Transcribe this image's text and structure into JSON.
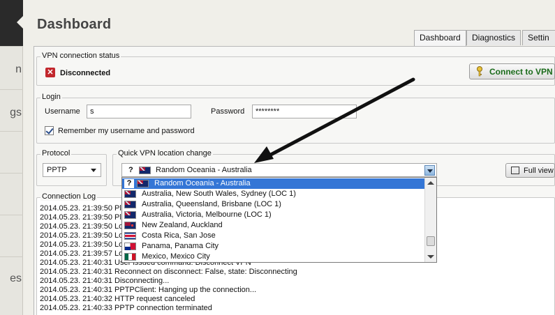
{
  "sidebar": {
    "items": [
      "n",
      "gs",
      "es"
    ]
  },
  "header": {
    "title": "Dashboard"
  },
  "tabs": [
    {
      "label": "Dashboard",
      "active": true
    },
    {
      "label": "Diagnostics"
    },
    {
      "label": "Settin"
    }
  ],
  "vpn_status": {
    "title": "VPN connection status",
    "status": "Disconnected",
    "connect_label": "Connect to VPN"
  },
  "login": {
    "title": "Login",
    "username_label": "Username",
    "username_value": "s",
    "password_label": "Password",
    "password_value": "********",
    "remember_label": "Remember my username and password"
  },
  "protocol": {
    "title": "Protocol",
    "value": "PPTP"
  },
  "location": {
    "title": "Quick VPN location change",
    "selected": "Random Oceania - Australia",
    "options": [
      {
        "label": "Random Oceania - Australia",
        "flag": "au"
      },
      {
        "label": "Australia, New South Wales, Sydney (LOC 1)",
        "flag": "au"
      },
      {
        "label": "Australia, Queensland, Brisbane (LOC 1)",
        "flag": "au"
      },
      {
        "label": "Australia, Victoria, Melbourne (LOC 1)",
        "flag": "au"
      },
      {
        "label": "New Zealand, Auckland",
        "flag": "nz"
      },
      {
        "label": "Costa Rica, San Jose",
        "flag": "cr"
      },
      {
        "label": "Panama, Panama City",
        "flag": "pa"
      },
      {
        "label": "Mexico, Mexico City",
        "flag": "mx"
      }
    ]
  },
  "fullview_label": "Full view",
  "log": {
    "title": "Connection Log",
    "lines": [
      "2014.05.23. 21:39:50  Pl",
      "2014.05.23. 21:39:50  Pl",
      "2014.05.23. 21:39:50  Lo",
      "2014.05.23. 21:39:50  Lo",
      "2014.05.23. 21:39:50  Lo",
      "2014.05.23. 21:39:57  Lo",
      "2014.05.23. 21:40:31  User issued command:  Disconnect VPN",
      "2014.05.23. 21:40:31  Reconnect on disconnect: False, state: Disconnecting",
      "2014.05.23. 21:40:31  Disconnecting...",
      "2014.05.23. 21:40:31  PPTPClient: Hanging up the connection...",
      "2014.05.23. 21:40:32  HTTP request canceled",
      "2014.05.23. 21:40:33  PPTP connection terminated"
    ]
  }
}
